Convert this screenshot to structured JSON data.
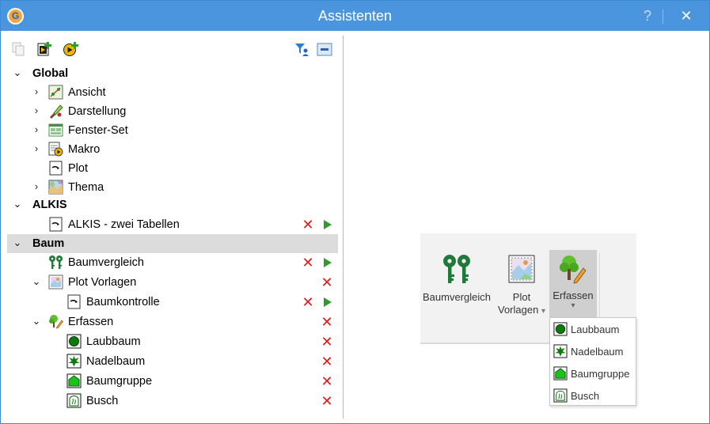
{
  "window": {
    "title": "Assistenten",
    "help": "?",
    "close": "✕"
  },
  "app_logo": "G",
  "tree": {
    "global": {
      "label": "Global",
      "items": [
        "Ansicht",
        "Darstellung",
        "Fenster-Set",
        "Makro",
        "Plot",
        "Thema"
      ]
    },
    "alkis": {
      "label": "ALKIS",
      "items": [
        "ALKIS - zwei Tabellen"
      ]
    },
    "baum": {
      "label": "Baum",
      "baumvergleich": "Baumvergleich",
      "plot_vorlagen": "Plot Vorlagen",
      "baumkontrolle": "Baumkontrolle",
      "erfassen": "Erfassen",
      "erfassen_items": [
        "Laubbaum",
        "Nadelbaum",
        "Baumgruppe",
        "Busch"
      ]
    }
  },
  "actions": {
    "delete": "✕"
  },
  "ribbon": {
    "baumvergleich": "Baumvergleich",
    "plot_line1": "Plot",
    "plot_line2": "Vorlagen",
    "erfassen": "Erfassen",
    "dropdown_arrow": "▾"
  },
  "dropdown": {
    "items": [
      "Laubbaum",
      "Nadelbaum",
      "Baumgruppe",
      "Busch"
    ]
  },
  "colors": {
    "titlebar": "#4a95dd",
    "delete": "#e01b1b",
    "play": "#2e9b2e",
    "tree_green": "#1f7a3a",
    "selected_row": "#dcdcdc"
  }
}
